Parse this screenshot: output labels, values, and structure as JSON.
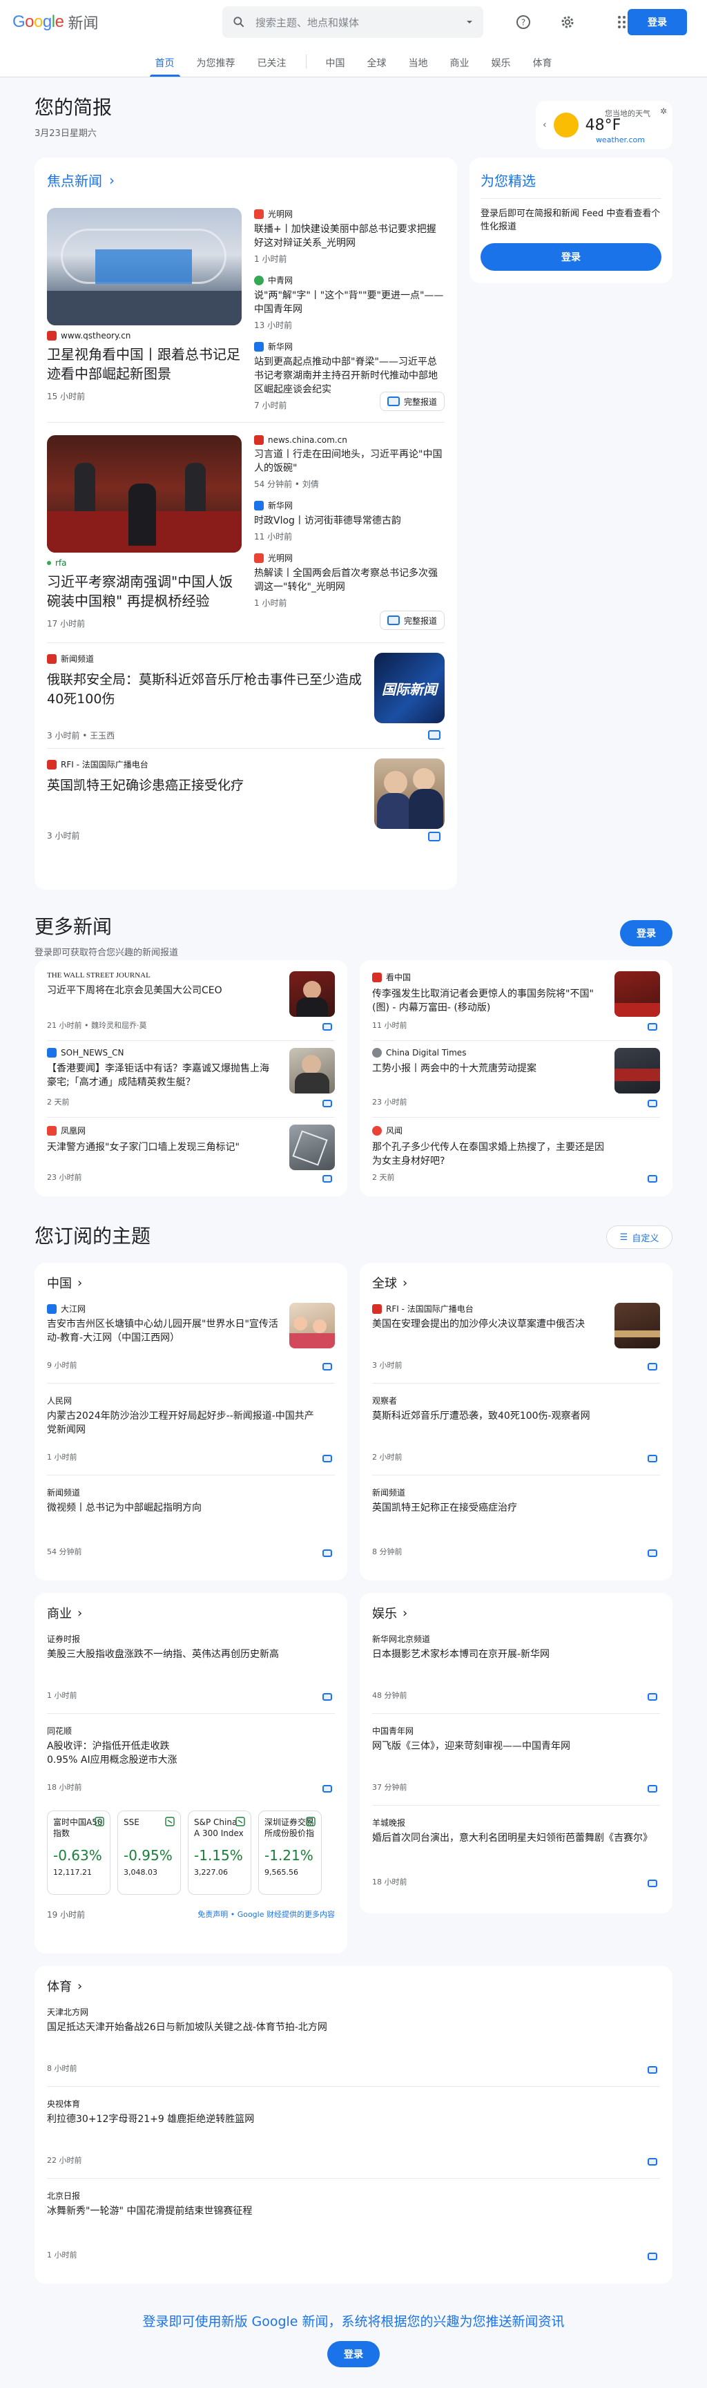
{
  "header": {
    "logo_google": "Google",
    "logo_news": "新闻",
    "search_placeholder": "搜索主题、地点和媒体",
    "signin": "登录"
  },
  "nav": [
    "首页",
    "为您推荐",
    "已关注",
    "中国",
    "全球",
    "当地",
    "商业",
    "娱乐",
    "体育"
  ],
  "brief": {
    "title": "您的简报",
    "date": "3月23日星期六"
  },
  "weather": {
    "label": "您当地的天气",
    "temp": "48°F",
    "source": "weather.com"
  },
  "top": {
    "title": "焦点新闻",
    "clusters": [
      {
        "main": {
          "source": "www.qstheory.cn",
          "headline": "卫星视角看中国丨跟着总书记足迹看中部崛起新图景",
          "time": "15 小时前"
        },
        "subs": [
          {
            "source": "光明网",
            "headline": "联播+丨加快建设美丽中部总书记要求把握好这对辩证关系_光明网",
            "time": "1 小时前"
          },
          {
            "source": "中青网",
            "headline": "说\"两\"解\"字\"丨\"这个\"背\"\"要\"更进一点\"——中国青年网",
            "time": "13 小时前"
          },
          {
            "source": "新华网",
            "headline": "站到更高起点推动中部\"脊梁\"——习近平总书记考察湖南并主持召开新时代推动中部地区崛起座谈会纪实",
            "time": "7 小时前"
          }
        ],
        "fullcov": "完整报道"
      },
      {
        "main": {
          "source": "rfa",
          "headline": "习近平考察湖南强调\"中国人饭碗装中国粮\" 再提枫桥经验",
          "time": "17 小时前"
        },
        "subs": [
          {
            "source": "news.china.com.cn",
            "headline": "习言道丨行走在田间地头，习近平再论\"中国人的饭碗\"",
            "time": "54 分钟前",
            "author": "刘倩"
          },
          {
            "source": "新华网",
            "headline": "时政Vlog丨访河街菲德导常德古韵",
            "time": "11 小时前"
          },
          {
            "source": "光明网",
            "headline": "热解读丨全国两会后首次考察总书记多次强调这一\"转化\"_光明网",
            "time": "1 小时前"
          }
        ],
        "fullcov": "完整报道"
      }
    ],
    "singles": [
      {
        "source": "新闻频道",
        "headline": "俄联邦安全局：莫斯科近郊音乐厅枪击事件已至少造成40死100伤",
        "time": "3 小时前",
        "author": "王玉西",
        "thumb": "国际新闻"
      },
      {
        "source": "RFI - 法国国际广播电台",
        "headline": "英国凯特王妃确诊患癌正接受化疗",
        "time": "3 小时前"
      }
    ]
  },
  "picks": {
    "title": "为您精选",
    "desc": "登录后即可在简报和新闻 Feed 中查看查看个性化报道",
    "button": "登录"
  },
  "more": {
    "title": "更多新闻",
    "sub": "登录即可获取符合您兴趣的新闻报道",
    "button": "登录",
    "items": [
      {
        "source": "THE WALL STREET JOURNAL",
        "headline": "习近平下周将在北京会见美国大公司CEO",
        "time": "21 小时前",
        "author": "魏玲灵和屈乔·莫"
      },
      {
        "source": "看中国",
        "headline": "传李强发生比取消记者会更惊人的事国务院将\"不国\"(图) - 内幕万富田- (移动版)",
        "time": "11 小时前"
      },
      {
        "source": "SOH_NEWS_CN",
        "headline": "【香港要闻】李泽钜话中有话？李嘉诚又爆抛售上海豪宅;「高才通」成陆精英救生艇？",
        "time": "2 天前"
      },
      {
        "source": "China Digital Times",
        "headline": "工势小报丨两会中的十大荒唐劳动提案",
        "time": "23 小时前"
      },
      {
        "source": "凤凰网",
        "headline": "天津警方通报\"女子家门口墙上发现三角标记\"",
        "time": "23 小时前"
      },
      {
        "source": "风闻",
        "headline": "那个孔子多少代传人在泰国求婚上热搜了，主要还是因为女主身材好吧?",
        "time": "2 天前"
      }
    ]
  },
  "subscribed": {
    "title": "您订阅的主题",
    "custom": "自定义",
    "china": {
      "title": "中国",
      "items": [
        {
          "source": "大江网",
          "headline": "吉安市吉州区长塘镇中心幼儿园开展\"世界水日\"宣传活动-教育-大江网（中国江西网）",
          "time": "9 小时前"
        },
        {
          "source": "人民网",
          "headline": "内蒙古2024年防沙治沙工程开好局起好步--新闻报道-中国共产党新闻网",
          "time": "1 小时前"
        },
        {
          "source": "新闻频道",
          "headline": "微视频丨总书记为中部崛起指明方向",
          "time": "54 分钟前"
        }
      ]
    },
    "global": {
      "title": "全球",
      "items": [
        {
          "source": "RFI - 法国国际广播电台",
          "headline": "美国在安理会提出的加沙停火决议草案遭中俄否决",
          "time": "3 小时前"
        },
        {
          "source": "观察者",
          "headline": "莫斯科近郊音乐厅遭恐袭，致40死100伤-观察者网",
          "time": "2 小时前"
        },
        {
          "source": "新闻频道",
          "headline": "英国凯特王妃称正在接受癌症治疗",
          "time": "8 分钟前"
        }
      ]
    },
    "business": {
      "title": "商业",
      "items": [
        {
          "source": "证券时报",
          "headline": "美股三大股指收盘涨跌不一纳指、英伟达再创历史新高",
          "time": "1 小时前"
        },
        {
          "source": "同花顺",
          "headline": "A股收评：沪指低开低走收跌0.95% AI应用概念股逆市大涨",
          "time": "18 小时前"
        }
      ],
      "stocks": [
        {
          "name": "富时中国A50指数",
          "change": "-0.63%",
          "price": "12,117.21"
        },
        {
          "name": "SSE",
          "change": "-0.95%",
          "price": "3,048.03"
        },
        {
          "name": "S&P China A 300 Index (CNY)",
          "change": "-1.15%",
          "price": "3,227.06"
        },
        {
          "name": "深圳证券交易所成份股价指数",
          "change": "-1.21%",
          "price": "9,565.56"
        }
      ],
      "footer_time": "19 小时前",
      "disclaimer": "免责声明 • Google 财经提供的更多内容"
    },
    "ent": {
      "title": "娱乐",
      "items": [
        {
          "source": "新华网北京频道",
          "headline": "日本摄影艺术家杉本博司在京开展-新华网",
          "time": "48 分钟前"
        },
        {
          "source": "中国青年网",
          "headline": "网飞版《三体》，迎来苛刻审视——中国青年网",
          "time": "37 分钟前"
        },
        {
          "source": "羊城晚报",
          "headline": "婚后首次同台演出，意大利名团明星夫妇领衔芭蕾舞剧《吉赛尔》",
          "time": "18 小时前"
        }
      ]
    },
    "sports": {
      "title": "体育",
      "items": [
        {
          "source": "天津北方网",
          "headline": "国足抵达天津开始备战26日与新加坡队关键之战-体育节拍-北方网",
          "time": "8 小时前"
        },
        {
          "source": "央视体育",
          "headline": "利拉德30+12字母哥21+9 雄鹿拒绝逆转胜篮网",
          "time": "22 小时前"
        },
        {
          "source": "北京日报",
          "headline": "冰舞新秀\"一轮游\" 中国花滑提前结束世锦赛征程",
          "time": "1 小时前"
        }
      ]
    }
  },
  "footer": {
    "text": "登录即可使用新版 Google 新闻，系统将根据您的兴趣为您推送新闻资讯",
    "button": "登录"
  }
}
